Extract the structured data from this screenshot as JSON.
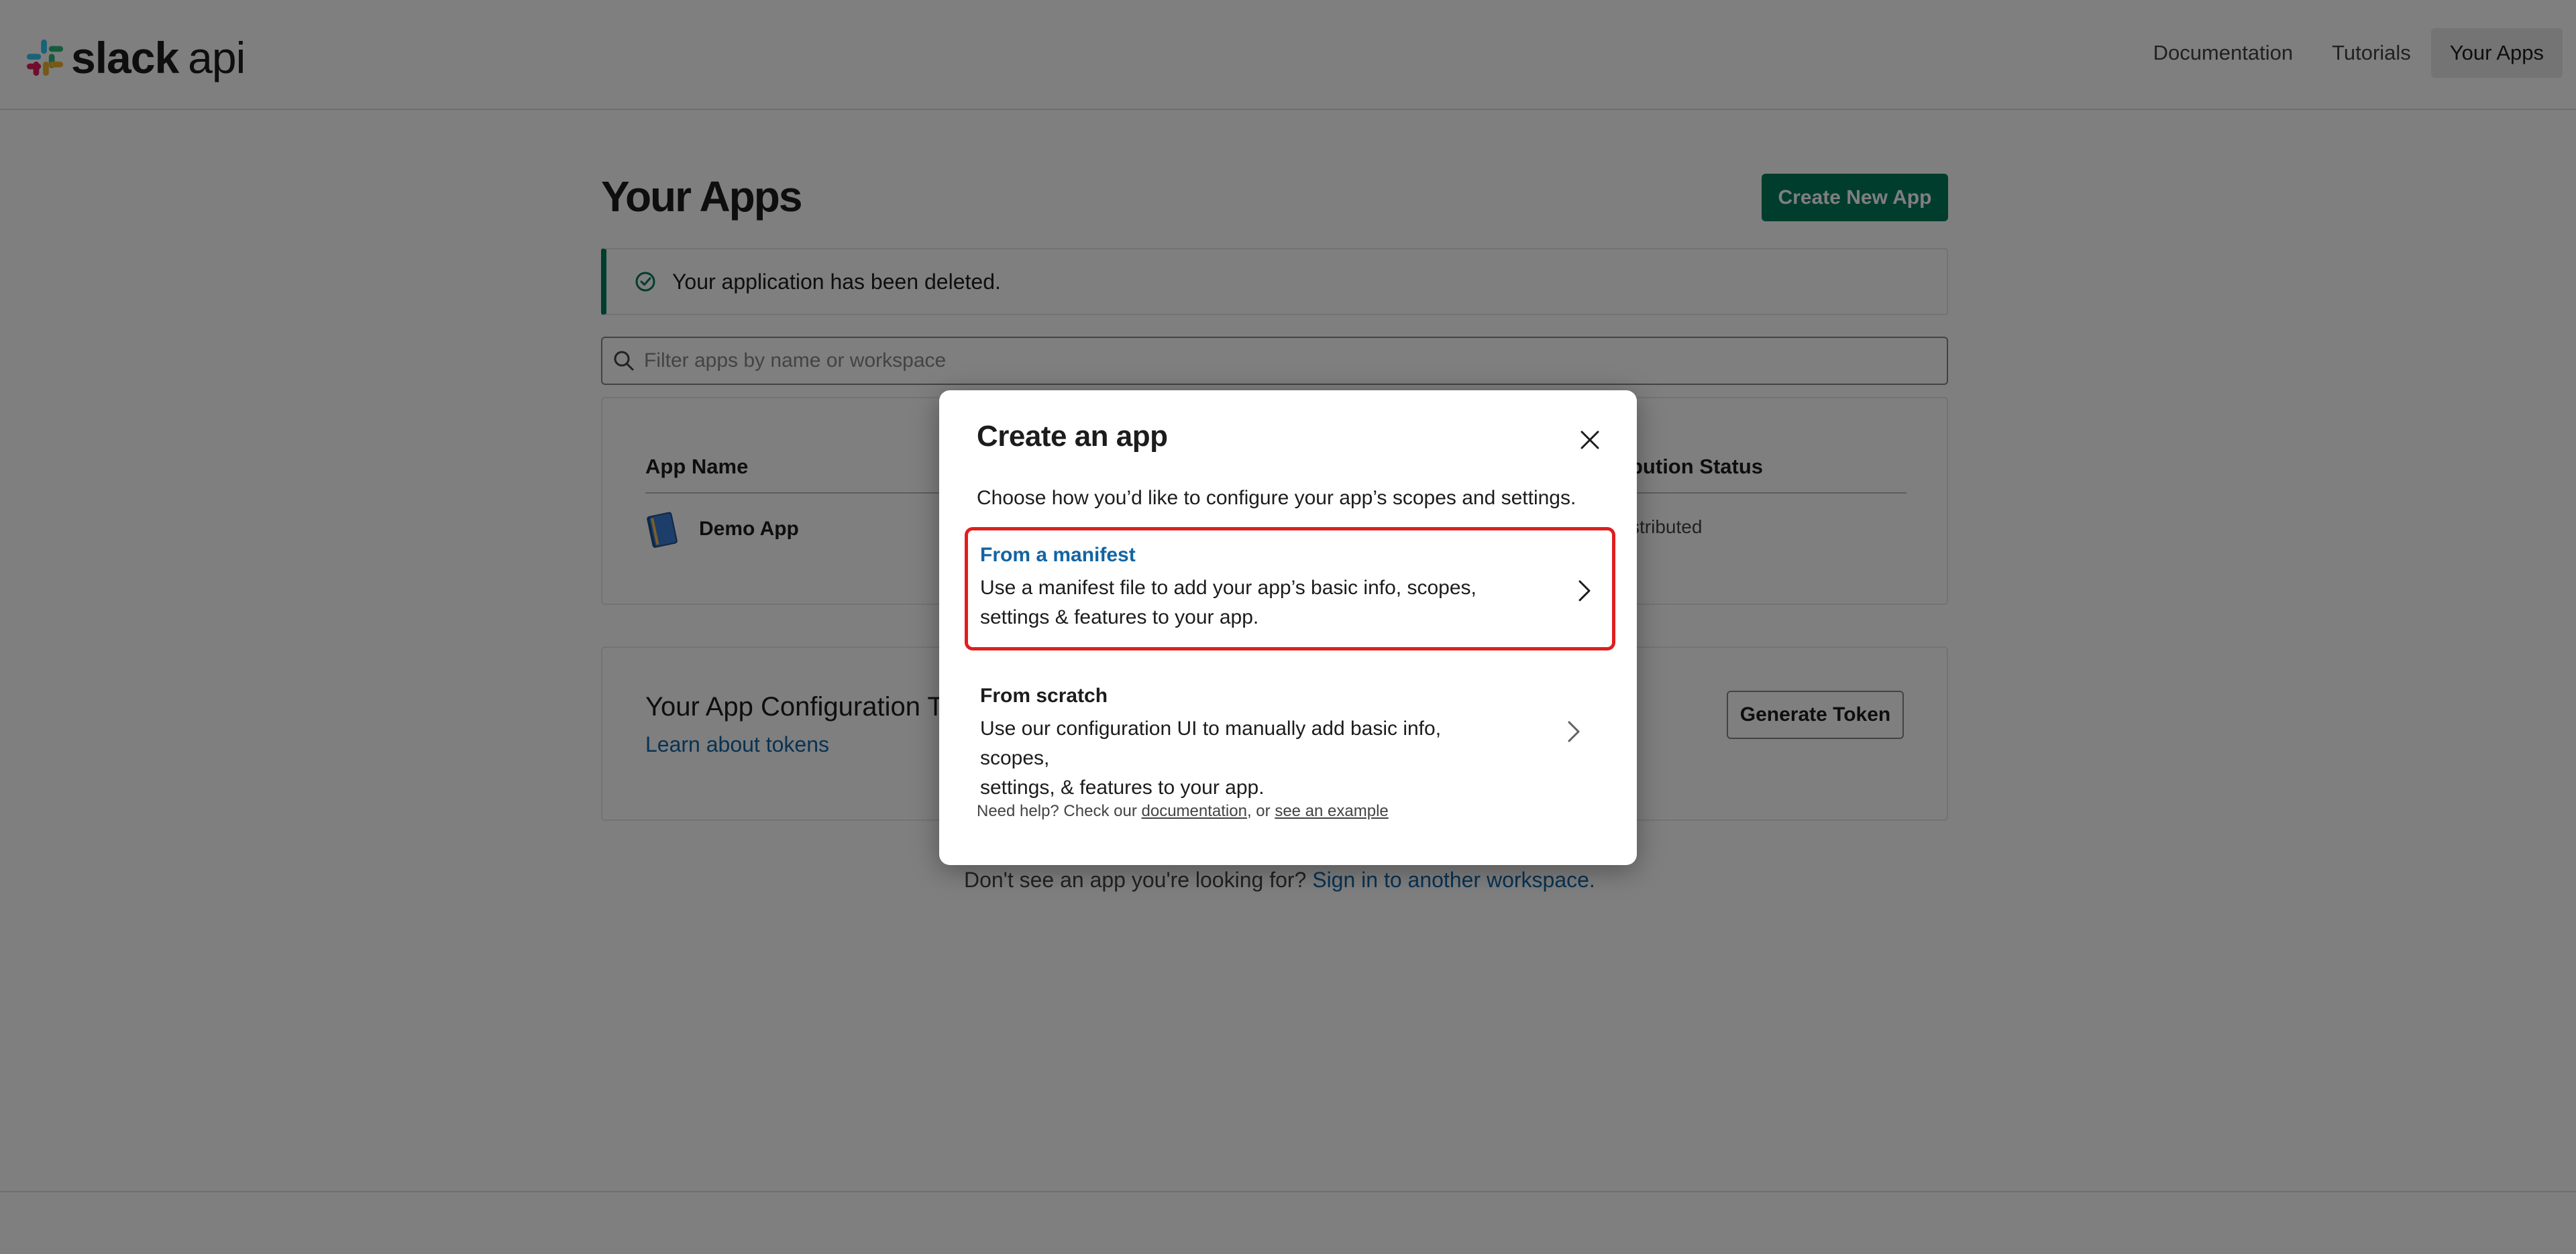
{
  "header": {
    "logo_text_bold": "slack",
    "logo_text_light": "api",
    "nav": [
      "Documentation",
      "Tutorials",
      "Your Apps"
    ]
  },
  "main": {
    "title": "Your Apps",
    "create_button": "Create New App",
    "notice": "Your application has been deleted.",
    "search_placeholder": "Filter apps by name or workspace",
    "table": {
      "col_name": "App Name",
      "col_status_visible": "bution Status",
      "rows": [
        {
          "name": "Demo App",
          "status_visible": "stributed"
        }
      ]
    },
    "token_card": {
      "title_visible": "Your App Configuration T",
      "link": "Learn about tokens",
      "button": "Generate Token"
    },
    "footer_prefix_visible": "Don't see an app you're looking for?",
    "footer_link": "Sign in to another workspace."
  },
  "modal": {
    "title": "Create an app",
    "subtitle": "Choose how you’d like to configure your app’s scopes and settings.",
    "options": [
      {
        "title": "From a manifest",
        "line1": "Use a manifest file to add your app’s basic info, scopes,",
        "line2": "settings & features to your app."
      },
      {
        "title": "From scratch",
        "line1": "Use our configuration UI to manually add basic info, scopes,",
        "line2": "settings, & features to your app."
      }
    ],
    "help_prefix": "Need help? Check our",
    "help_link1": "documentation",
    "help_sep": ", or",
    "help_link2": "see an example"
  },
  "colors": {
    "brand_green": "#007a5a",
    "link_blue": "#1264a3",
    "highlight_red": "#e01e1e"
  }
}
